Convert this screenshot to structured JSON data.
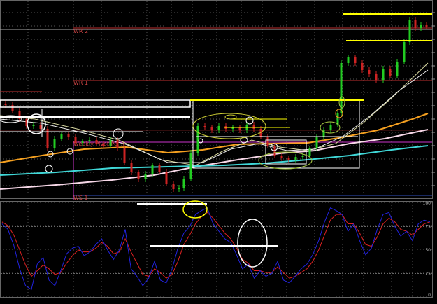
{
  "chart_data": [
    {
      "type": "line",
      "panel": "price",
      "title": "",
      "grid": true,
      "level_labels": [
        "WR 2",
        "WR 1",
        "Weekly Pivot Point",
        "WS 1"
      ],
      "series": [
        {
          "values_approx": [
            0.0
          ]
        }
      ],
      "note_visible_marks": []
    },
    {
      "type": "line",
      "panel": "oscillator",
      "title": "",
      "ylim": [
        0,
        100
      ],
      "y_tick_labels": [
        "100",
        "75",
        "50",
        "25",
        "0"
      ],
      "levels": [
        75,
        25
      ],
      "series": [
        {
          "color": "#2222dd"
        },
        {
          "color": "#dd2222"
        }
      ]
    }
  ],
  "colors": {
    "background": "#000000",
    "grid": "#555555",
    "resistance": "#c03030",
    "support": "#3050c0",
    "pivot": "#cc33cc",
    "ma_orange": "#f5a020",
    "ma_pink": "#f7d8e8",
    "ma_cyan": "#40d8d8",
    "ma_thin": "#d8d8a0",
    "annotation_white": "#ffffff",
    "annotation_yellow": "#ffff00",
    "annotation_green": "#88cc44",
    "candle_up": "#22cc22",
    "candle_down": "#cc2222"
  }
}
